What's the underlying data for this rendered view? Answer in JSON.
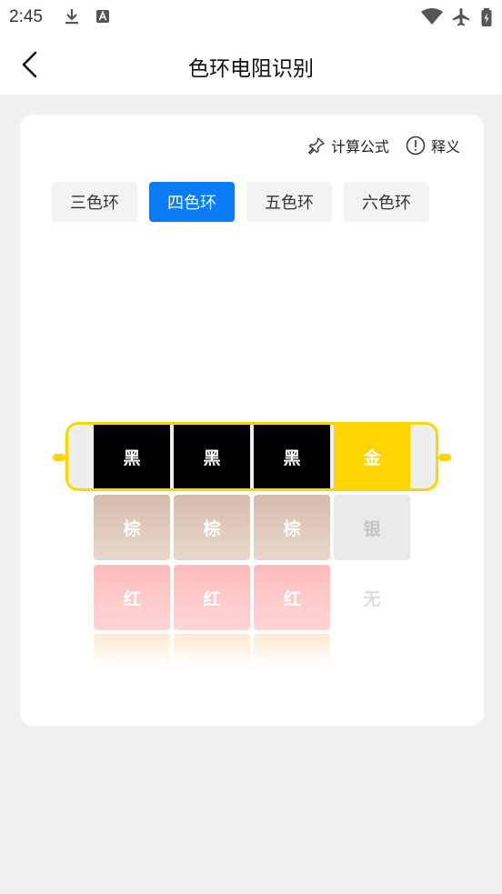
{
  "status_bar": {
    "time": "2:45",
    "icons": [
      "download-icon",
      "text-icon",
      "wifi-icon",
      "airplane-icon",
      "battery-icon"
    ]
  },
  "header": {
    "title": "色环电阻识别",
    "back_icon": "chevron-left-icon"
  },
  "card": {
    "formula_label": "计算公式",
    "explain_label": "释义",
    "tabs": [
      {
        "label": "三色环",
        "active": false
      },
      {
        "label": "四色环",
        "active": true
      },
      {
        "label": "五色环",
        "active": false
      },
      {
        "label": "六色环",
        "active": false
      }
    ],
    "selected_bands": [
      "黑",
      "黑",
      "黑",
      "金"
    ],
    "band_options": {
      "row1": [
        "棕",
        "棕",
        "棕",
        "银"
      ],
      "row2": [
        "红",
        "红",
        "红",
        "无"
      ]
    }
  },
  "colors": {
    "accent": "#0a7cf5",
    "body_border": "#ffd500",
    "black_band": "#000000",
    "gold_band": "#ffd500",
    "brown_option": "#d5bbaa",
    "red_option": "#ffc3c3",
    "silver_option": "#e8e8e8"
  }
}
